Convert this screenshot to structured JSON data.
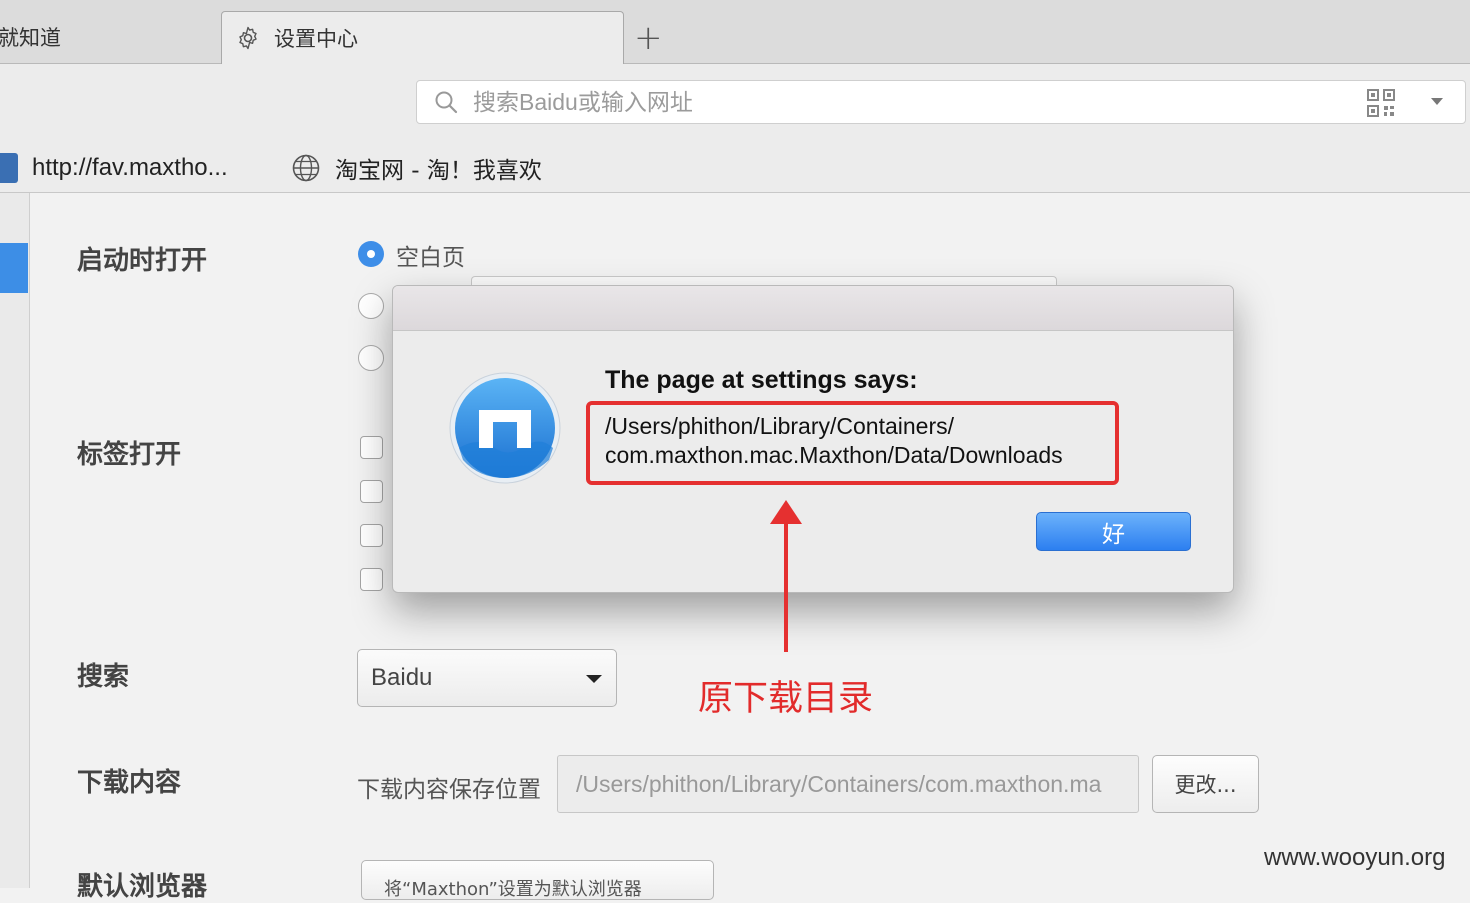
{
  "tabs": [
    {
      "label": "就知道"
    },
    {
      "label": "设置中心",
      "icon": "gear-icon"
    }
  ],
  "new_tab": "+",
  "address_bar": {
    "placeholder": "搜索Baidu或输入网址"
  },
  "bookmarks": [
    {
      "label": "http://fav.maxtho...",
      "icon": "contacts-icon"
    },
    {
      "label": "淘宝网 - 淘！我喜欢",
      "icon": "globe-icon"
    }
  ],
  "settings": {
    "startup": {
      "label": "启动时打开",
      "options": [
        "空白页"
      ]
    },
    "tabs": {
      "label": "标签打开"
    },
    "search": {
      "label": "搜索",
      "engine": "Baidu"
    },
    "downloads": {
      "label": "下载内容",
      "save_location_label": "下载内容保存位置",
      "path": "/Users/phithon/Library/Containers/com.maxthon.ma",
      "change_button": "更改..."
    },
    "default_browser": {
      "label": "默认浏览器",
      "button": "将“Maxthon”设置为默认浏览器"
    }
  },
  "dialog": {
    "title": "The page at settings says:",
    "message_line1": "/Users/phithon/Library/Containers/",
    "message_line2": "com.maxthon.mac.Maxthon/Data/Downloads",
    "ok_button": "好"
  },
  "annotation": {
    "text": "原下载目录",
    "color": "#e53030"
  },
  "watermark": "www.wooyun.org",
  "colors": {
    "accent": "#3e8ee8",
    "annotation": "#e53030"
  }
}
